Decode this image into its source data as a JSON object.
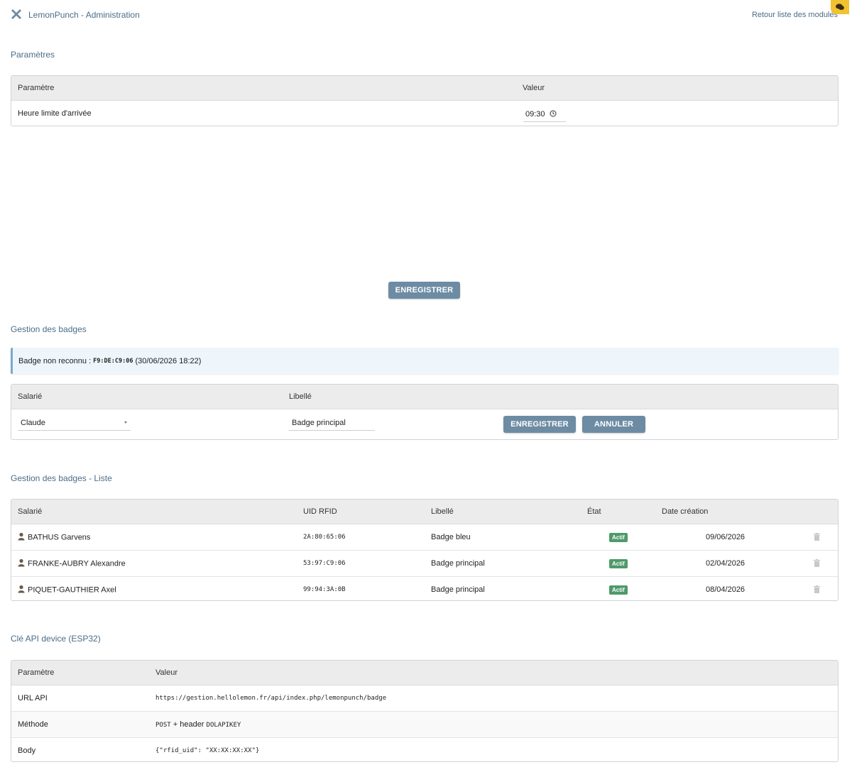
{
  "header": {
    "app_title": "LemonPunch - Administration",
    "back_link": "Retour liste des modules"
  },
  "parametres": {
    "title": "Paramètres",
    "col_param": "Paramètre",
    "col_value": "Valeur",
    "rows": [
      {
        "label": "Heure limite d'arrivée",
        "value": "09:30"
      }
    ],
    "save_label": "ENREGISTRER"
  },
  "badges": {
    "title": "Gestion des badges",
    "notice_prefix": "Badge non reconnu :",
    "notice_uid": "F9:DE:C9:06",
    "notice_date": "(30/06/2026 18:22)",
    "col_employee": "Salarié",
    "col_label": "Libellé",
    "employee_value": "Claude",
    "label_value": "Badge principal",
    "save_label": "ENREGISTRER",
    "cancel_label": "ANNULER"
  },
  "badge_list": {
    "title": "Gestion des badges - Liste",
    "columns": [
      "Salarié",
      "UID RFID",
      "Libellé",
      "État",
      "Date création"
    ],
    "rows": [
      {
        "employee": "BATHUS Garvens",
        "uid": "2A:80:65:06",
        "label": "Badge bleu",
        "state": "Actif",
        "date": "09/06/2026"
      },
      {
        "employee": "FRANKE-AUBRY Alexandre",
        "uid": "53:97:C9:06",
        "label": "Badge principal",
        "state": "Actif",
        "date": "02/04/2026"
      },
      {
        "employee": "PIQUET-GAUTHIER Axel",
        "uid": "99:94:3A:0B",
        "label": "Badge principal",
        "state": "Actif",
        "date": "08/04/2026"
      }
    ]
  },
  "api": {
    "title": "Clé API device (ESP32)",
    "col_param": "Paramètre",
    "col_value": "Valeur",
    "url_label": "URL API",
    "url_value": "https://gestion.hellolemon.fr/api/index.php/lemonpunch/badge",
    "method_label": "Méthode",
    "method_code": "POST",
    "method_text": " + header ",
    "method_header": "DOLAPIKEY",
    "body_label": "Body",
    "body_value": "{\"rfid_uid\": \"XX:XX:XX:XX\"}"
  },
  "colors": {
    "accent": "#4a6d88",
    "button": "#6d8ca4",
    "active_badge": "#4e9a6a",
    "notice_bg": "#eef5fb"
  },
  "icons": [
    "tools-icon",
    "chat-icon",
    "clock-icon",
    "user-icon",
    "trash-icon"
  ]
}
